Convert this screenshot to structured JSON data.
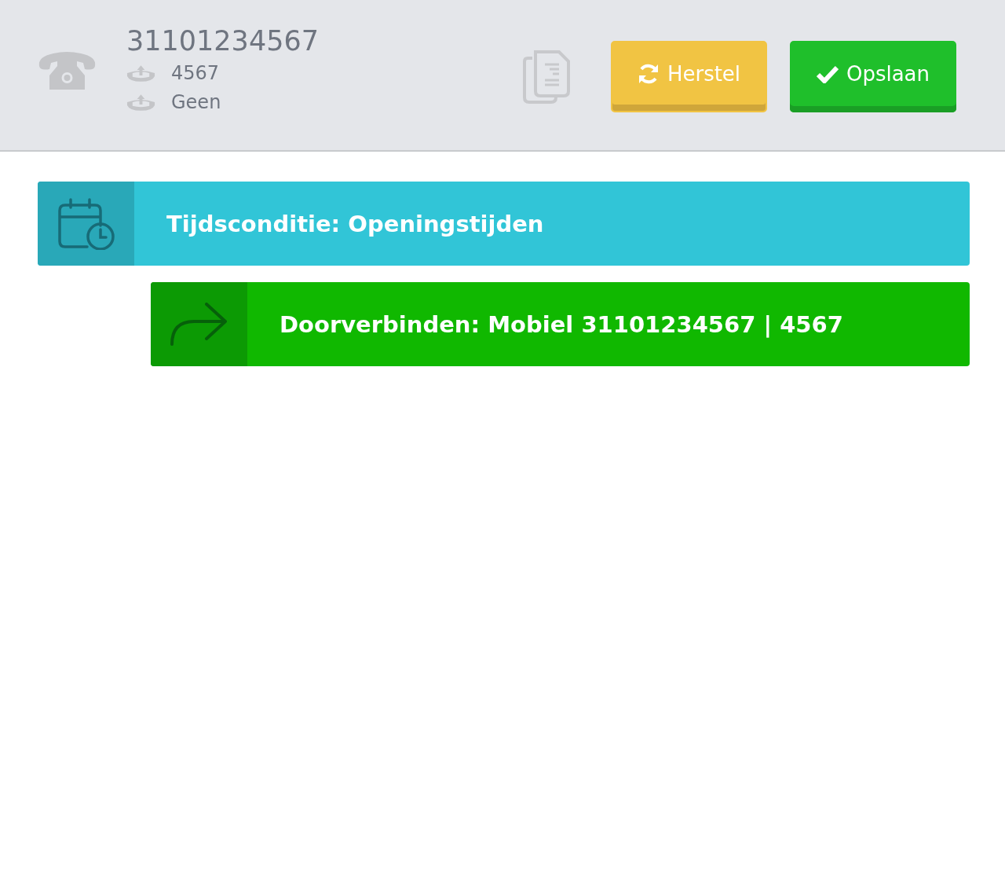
{
  "header": {
    "number": "31101234567",
    "lines": [
      {
        "text": "4567"
      },
      {
        "text": "Geen"
      }
    ]
  },
  "buttons": [
    {
      "kind": "reset",
      "label": "Herstel"
    },
    {
      "kind": "save",
      "label": "Opslaan"
    }
  ],
  "flow": [
    {
      "kind": "time_condition",
      "label": "Tijdsconditie: Openingstijden",
      "children": [
        {
          "kind": "forward",
          "label": "Doorverbinden: Mobiel 31101234567 | 4567"
        }
      ]
    }
  ]
}
